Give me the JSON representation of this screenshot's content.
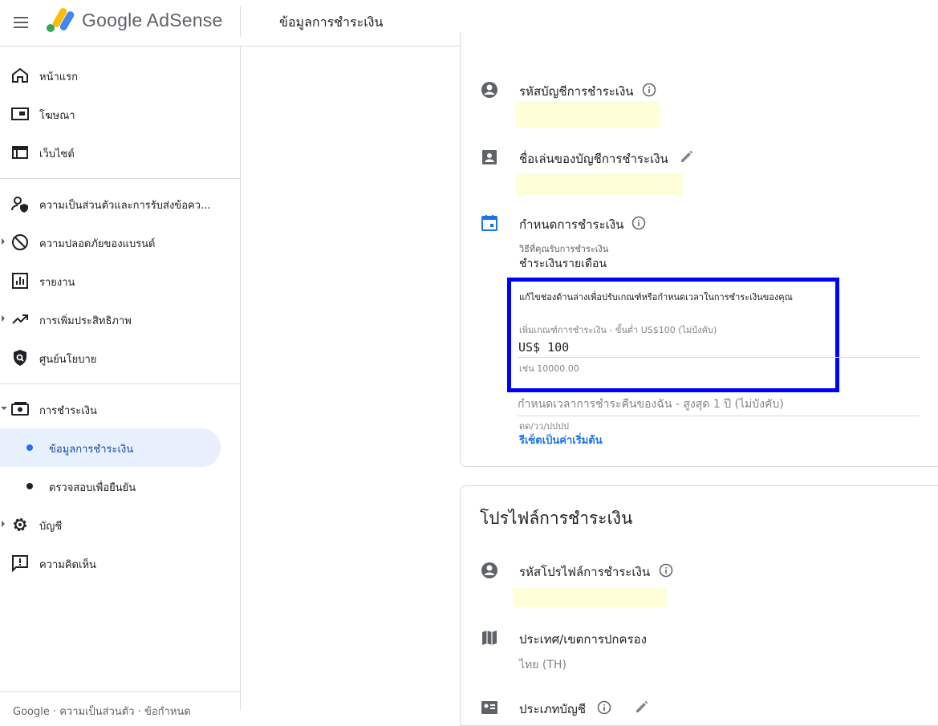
{
  "header": {
    "brand": "Google AdSense",
    "page_title": "ข้อมูลการชำระเงิน"
  },
  "sidebar": {
    "items": [
      {
        "label": "หน้าแรก",
        "icon": "home-icon"
      },
      {
        "label": "โฆษณา",
        "icon": "ads-icon"
      },
      {
        "label": "เว็บไซต์",
        "icon": "sites-icon"
      },
      {
        "label": "ความเป็นส่วนตัวและการรับส่งข้อคว...",
        "icon": "privacy-icon"
      },
      {
        "label": "ความปลอดภัยของแบรนด์",
        "icon": "block-icon"
      },
      {
        "label": "รายงาน",
        "icon": "reports-icon"
      },
      {
        "label": "การเพิ่มประสิทธิภาพ",
        "icon": "trending-up-icon"
      },
      {
        "label": "ศูนย์นโยบาย",
        "icon": "policy-shield-icon"
      },
      {
        "label": "การชำระเงิน",
        "icon": "payments-icon"
      },
      {
        "label": "บัญชี",
        "icon": "gear-icon"
      },
      {
        "label": "ความคิดเห็น",
        "icon": "feedback-icon"
      }
    ],
    "sub_items": [
      {
        "label": "ข้อมูลการชำระเงิน",
        "active": true
      },
      {
        "label": "ตรวจสอบเพื่อยืนยัน",
        "active": false
      }
    ],
    "footer": "Google · ความเป็นส่วนตัว · ข้อกำหนด"
  },
  "payment_account": {
    "account_id_label": "รหัสบัญชีการชำระเงิน",
    "nickname_label": "ชื่อเล่นของบัญชีการชำระเงิน",
    "schedule_label": "กำหนดการชำระเงิน",
    "method_caption": "วิธีที่คุณรับการชำระเงิน",
    "method_value": "ชำระเงินรายเดือน",
    "hint": "แก้ไขช่องด้านล่างเพื่อปรับเกณฑ์หรือกำหนดเวลาในการชำระเงินของคุณ",
    "threshold_label": "เพิ่มเกณฑ์การชำระเงิน - ขั้นต่ำ US$100 (ไม่บังคับ)",
    "threshold_value": "US$ 100",
    "threshold_example": "เช่น 10000.00",
    "schedule_field": "กำหนดเวลาการชำระคืนของฉัน - สูงสุด 1 ปี (ไม่บังคับ)",
    "date_format": "ดด/วว/ปปปป",
    "reset_link": "รีเซ็ตเป็นค่าเริ่มต้น"
  },
  "payment_profile": {
    "title": "โปรไฟล์การชำระเงิน",
    "profile_id_label": "รหัสโปรไฟล์การชำระเงิน",
    "country_label": "ประเทศ/เขตการปกครอง",
    "country_value": "ไทย (TH)",
    "account_type_label": "ประเภทบัญชี"
  },
  "colors": {
    "accent": "#1a73e8",
    "highlight_border": "#0000ff",
    "redacted_fill": "#feffd9"
  }
}
